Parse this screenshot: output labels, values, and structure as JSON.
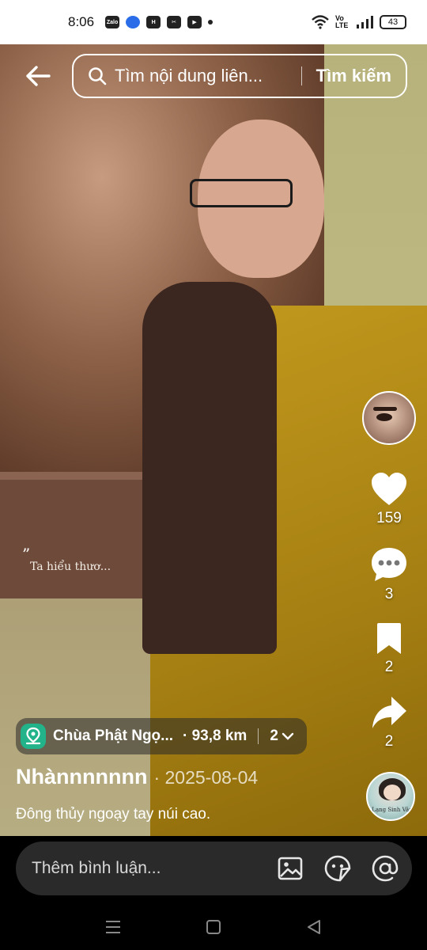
{
  "status_bar": {
    "time": "8:06",
    "apps": [
      "Zalo",
      "messenger",
      "H",
      "capcut",
      "youtube"
    ],
    "network": "Vo LTE",
    "battery": "43"
  },
  "search": {
    "placeholder": "Tìm nội dung liên...",
    "button_label": "Tìm kiếm"
  },
  "video": {
    "overlay_quote": "”",
    "overlay_text": "Ta hiểu thươ..."
  },
  "actions": {
    "likes": "159",
    "comments": "3",
    "bookmarks": "2",
    "shares": "2"
  },
  "location": {
    "name": "Chùa Phật Ngọ...",
    "distance": "· 93,8 km",
    "count": "2"
  },
  "post": {
    "author": "Nhànnnnnnn",
    "date": "· 2025-08-04",
    "caption": "Đông thủy ngoạy tay núi cao."
  },
  "music": {
    "label": "Lạng Sinh Vân"
  },
  "comment_bar": {
    "placeholder": "Thêm bình luận..."
  },
  "colors": {
    "accent_location": "#23b38a",
    "robe": "#b08a18"
  }
}
